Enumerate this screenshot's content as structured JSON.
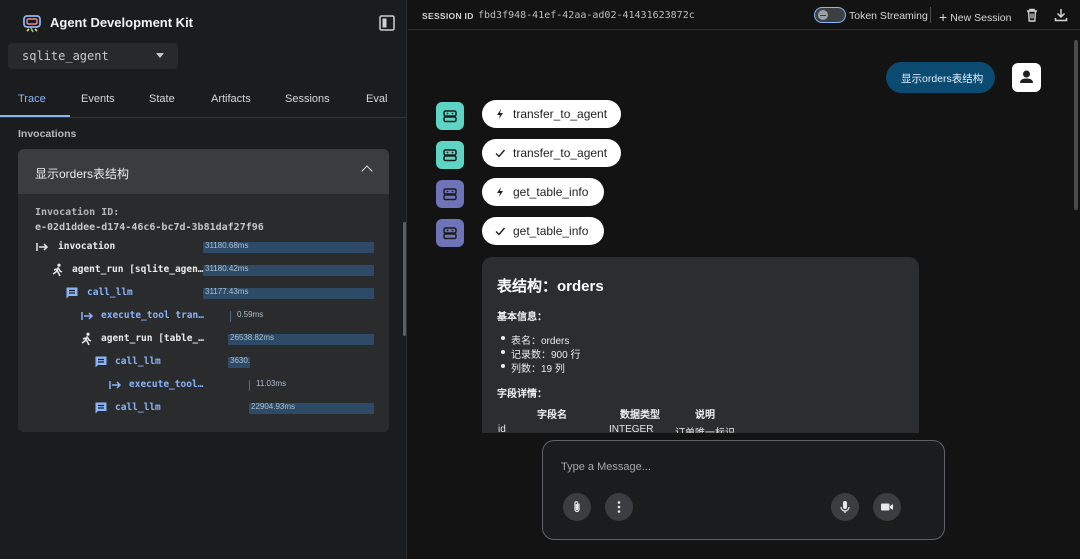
{
  "app": {
    "title": "Agent Development Kit",
    "agent_selected": "sqlite_agent"
  },
  "tabs": [
    {
      "label": "Trace",
      "active": true
    },
    {
      "label": "Events",
      "active": false
    },
    {
      "label": "State",
      "active": false
    },
    {
      "label": "Artifacts",
      "active": false
    },
    {
      "label": "Sessions",
      "active": false
    },
    {
      "label": "Eval",
      "active": false
    }
  ],
  "invocations": {
    "section_label": "Invocations",
    "query": "显示orders表结构",
    "id_label": "Invocation ID:",
    "id": "e-02d1ddee-d174-46c6-bc7d-3b81daf27f96",
    "trace": [
      {
        "icon": "arrow-into-icon",
        "name": "invocation",
        "time": "31180.68ms"
      },
      {
        "icon": "agent-run-icon",
        "name": "agent_run [sqlite_agen…",
        "time": "31180.42ms"
      },
      {
        "icon": "llm-call-icon",
        "name": "call_llm",
        "time": "31177.43ms"
      },
      {
        "icon": "arrow-into-icon",
        "name": "execute_tool tran…",
        "time": "0.59ms"
      },
      {
        "icon": "agent-run-icon",
        "name": "agent_run [table_…",
        "time": "26538.82ms"
      },
      {
        "icon": "llm-call-icon",
        "name": "call_llm",
        "time": "3630."
      },
      {
        "icon": "arrow-into-icon",
        "name": "execute_tool…",
        "time": "11.03ms"
      },
      {
        "icon": "llm-call-icon",
        "name": "call_llm",
        "time": "22904.93ms"
      }
    ]
  },
  "session": {
    "label": "SESSION ID",
    "id": "fbd3f948-41ef-42aa-ad02-41431623872c",
    "token_streaming_label": "Token Streaming",
    "token_streaming_on": false,
    "new_session_label": "New Session"
  },
  "chat": {
    "user_message": "显示orders表结构",
    "function_calls": [
      {
        "kind": "call",
        "label": "transfer_to_agent",
        "agent_color": "#5ed5c4"
      },
      {
        "kind": "response",
        "label": "transfer_to_agent",
        "agent_color": "#5ed5c4"
      },
      {
        "kind": "call",
        "label": "get_table_info",
        "agent_color": "#6f74b8"
      },
      {
        "kind": "response",
        "label": "get_table_info",
        "agent_color": "#6f74b8"
      }
    ],
    "response": {
      "title": "表结构：orders",
      "basic_info_label": "基本信息：",
      "basic_info": [
        "表名：orders",
        "记录数：900 行",
        "列数：19 列"
      ],
      "fields_label": "字段详情：",
      "table_headers": [
        "字段名",
        "数据类型",
        "说明"
      ],
      "first_row": [
        "id",
        "INTEGER",
        "订单唯一标识"
      ]
    }
  },
  "composer": {
    "placeholder": "Type a Message..."
  },
  "colors": {
    "accent": "#8ab4f8",
    "user_bubble": "#0b4a71",
    "agent_teal": "#5ed5c4",
    "agent_purple": "#6f74b8"
  }
}
